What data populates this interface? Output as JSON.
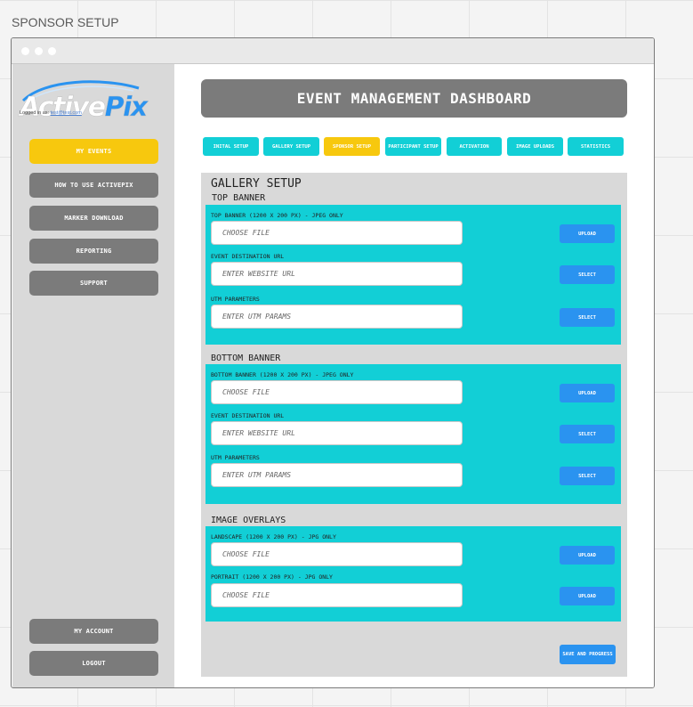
{
  "page_label": "SPONSOR SETUP",
  "sidebar": {
    "brand": "ActivePix",
    "logged_in_label": "Logged in as:",
    "logged_in_email": "test@test.com",
    "items": [
      {
        "label": "MY EVENTS",
        "active": true
      },
      {
        "label": "HOW TO USE ACTIVEPIX",
        "active": false
      },
      {
        "label": "MARKER DOWNLOAD",
        "active": false
      },
      {
        "label": "REPORTING",
        "active": false
      },
      {
        "label": "SUPPORT",
        "active": false
      }
    ],
    "bottom_items": [
      {
        "label": "MY ACCOUNT"
      },
      {
        "label": "LOGOUT"
      }
    ]
  },
  "header": {
    "title": "EVENT MANAGEMENT DASHBOARD"
  },
  "tabs": [
    {
      "label": "INITAL SETUP",
      "active": false
    },
    {
      "label": "GALLERY SETUP",
      "active": false
    },
    {
      "label": "SPONSOR SETUP",
      "active": true
    },
    {
      "label": "PARTICIPANT SETUP",
      "active": false
    },
    {
      "label": "ACTIVATION",
      "active": false
    },
    {
      "label": "IMAGE UPLOADS",
      "active": false
    },
    {
      "label": "STATISTICS",
      "active": false
    }
  ],
  "panel": {
    "title": "GALLERY SETUP",
    "top_banner": {
      "title": "TOP BANNER",
      "fields": [
        {
          "label": "TOP BANNER (1200 X 200 PX) - JPEG ONLY",
          "placeholder": "CHOOSE FILE",
          "action": "UPLOAD"
        },
        {
          "label": "EVENT DESTINATION URL",
          "placeholder": "ENTER WEBSITE URL",
          "action": "SELECT"
        },
        {
          "label": "UTM PARAMETERS",
          "placeholder": "ENTER UTM PARAMS",
          "action": "SELECT"
        }
      ]
    },
    "bottom_banner": {
      "title": "BOTTOM BANNER",
      "fields": [
        {
          "label": "BOTTOM BANNER (1200 X 200 PX) - JPEG ONLY",
          "placeholder": "CHOOSE FILE",
          "action": "UPLOAD"
        },
        {
          "label": "EVENT DESTINATION URL",
          "placeholder": "ENTER WEBSITE URL",
          "action": "SELECT"
        },
        {
          "label": "UTM PARAMETERS",
          "placeholder": "ENTER UTM PARAMS",
          "action": "SELECT"
        }
      ]
    },
    "image_overlays": {
      "title": "IMAGE OVERLAYS",
      "fields": [
        {
          "label": "LANDSCAPE (1200 X 200 PX) - JPG ONLY",
          "placeholder": "CHOOSE FILE",
          "action": "UPLOAD"
        },
        {
          "label": "PORTRAIT (1200 X 200 PX) - JPG ONLY",
          "placeholder": "CHOOSE FILE",
          "action": "UPLOAD"
        }
      ]
    },
    "save_label": "SAVE AND PROGRESS"
  },
  "colors": {
    "accent_yellow": "#f7c80e",
    "accent_cyan": "#12cfd6",
    "button_blue": "#2a93f0",
    "button_gray": "#7b7b7b",
    "brand_blue": "#1e90e6"
  }
}
